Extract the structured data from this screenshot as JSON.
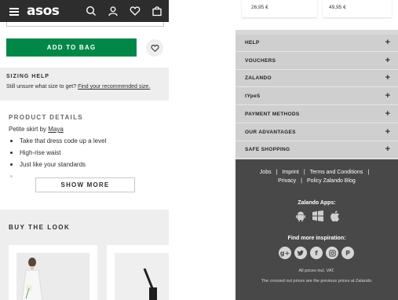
{
  "asos": {
    "header": {
      "logo": "asos",
      "icons": [
        "menu-icon",
        "search-icon",
        "account-icon",
        "saved-items-icon",
        "bag-icon"
      ]
    },
    "add_to_bag_label": "ADD TO BAG",
    "sizing_help": {
      "title": "SIZING HELP",
      "text": "Still unsure what size to get?",
      "link": "Find your recommended size."
    },
    "product_details": {
      "title": "PRODUCT DETAILS",
      "name_prefix": "Petite skirt by",
      "name_brand": "Maya",
      "bullets": [
        "Take that dress code up a level",
        "High-rise waist",
        "Just like your standards"
      ]
    },
    "show_more_label": "SHOW MORE",
    "buy_the_look_title": "BUY THE LOOK"
  },
  "zalando": {
    "prices": [
      "26,95 €",
      "49,95 €"
    ],
    "accordion": [
      {
        "label": "HELP"
      },
      {
        "label": "VOUCHERS"
      },
      {
        "label": "ZALANDO"
      },
      {
        "label": "tYpeS"
      },
      {
        "label": "PAYMENT METHODS"
      },
      {
        "label": "OUR ADVANTAGES"
      },
      {
        "label": "SAFE SHOPPING"
      }
    ],
    "footer": {
      "links": {
        "jobs": "Jobs",
        "imprint": "Imprint",
        "terms": "Terms and Conditions",
        "privacy": "Privacy",
        "policy": "Policy Zalando Blog"
      },
      "apps_title": "Zalando Apps:",
      "app_icons": [
        "android-icon",
        "windows-icon",
        "apple-icon"
      ],
      "inspiration_title": "Find more inspiration:",
      "social_icons": [
        "google-plus-icon",
        "twitter-icon",
        "facebook-icon",
        "instagram-icon",
        "pinterest-icon"
      ],
      "vat_text": "All prices incl. VAT.",
      "crossed_text": "The crossed out prices are the previous prices at Zalando."
    }
  }
}
